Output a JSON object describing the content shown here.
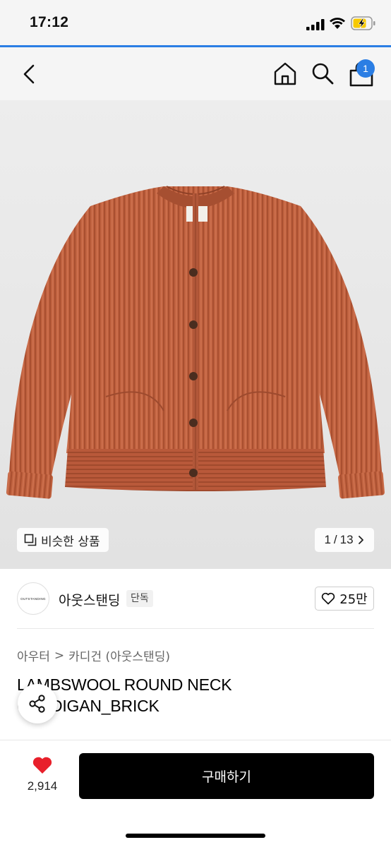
{
  "status_bar": {
    "time": "17:12"
  },
  "nav": {
    "cart_count": "1"
  },
  "gallery": {
    "similar_label": "비슷한 상품",
    "page_current": "1",
    "page_separator": "/",
    "page_total": "13",
    "product_color": "#c0623f"
  },
  "brand": {
    "logo_text": "OUTSTANDING",
    "name": "아웃스탠딩",
    "badge": "단독",
    "likes": "25만"
  },
  "breadcrumb": {
    "category": "아우터",
    "separator": ">",
    "subcategory": "카디건 (아웃스탠딩)"
  },
  "product": {
    "title": "LAMBSWOOL ROUND NECK CARDIGAN_BRICK"
  },
  "purchase": {
    "wish_count": "2,914",
    "buy_label": "구매하기"
  },
  "colors": {
    "accent": "#2b7ee4",
    "heart": "#e8202b",
    "buy_button": "#000000"
  }
}
